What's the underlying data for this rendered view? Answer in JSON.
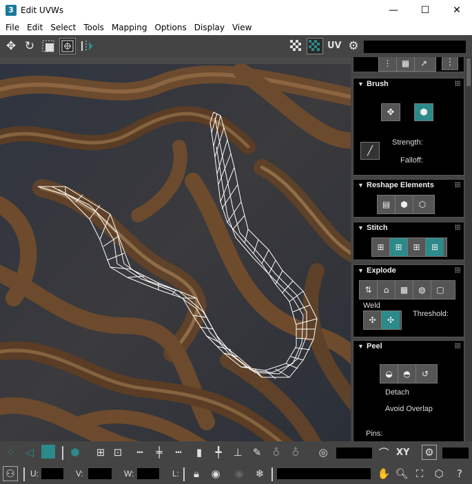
{
  "window": {
    "app_icon": "3",
    "title": "Edit UVWs",
    "min_glyph": "—",
    "max_glyph": "☐",
    "close_glyph": "✕"
  },
  "menu": [
    "File",
    "Edit",
    "Select",
    "Tools",
    "Mapping",
    "Options",
    "Display",
    "View"
  ],
  "top_toolbar": {
    "uv_label": "UV",
    "icons": [
      "move-icon",
      "rotate-icon",
      "scale-icon",
      "freeform-icon",
      "mirror-icon",
      "checker-icon",
      "checker-selected-icon",
      "settings-icon"
    ]
  },
  "panel": {
    "brush": {
      "title": "Brush",
      "strength_label": "Strength:",
      "falloff_label": "Falloff:"
    },
    "reshape": {
      "title": "Reshape Elements"
    },
    "stitch": {
      "title": "Stitch"
    },
    "explode": {
      "title": "Explode",
      "weld_label": "Weld",
      "threshold_label": "Threshold:"
    },
    "peel": {
      "title": "Peel",
      "detach_label": "Detach",
      "avoid_overlap_label": "Avoid Overlap",
      "pins_label": "Pins:"
    }
  },
  "bottom_toolbar": {
    "xy_label": "XY",
    "u_label": "U:",
    "v_label": "V:",
    "w_label": "W:",
    "l_label": "L:"
  },
  "colors": {
    "toolbar_bg": "#444444",
    "panel_section_bg": "#000000",
    "accent_teal": "#2d8a8a",
    "uv_mesh": "#ffffff"
  }
}
